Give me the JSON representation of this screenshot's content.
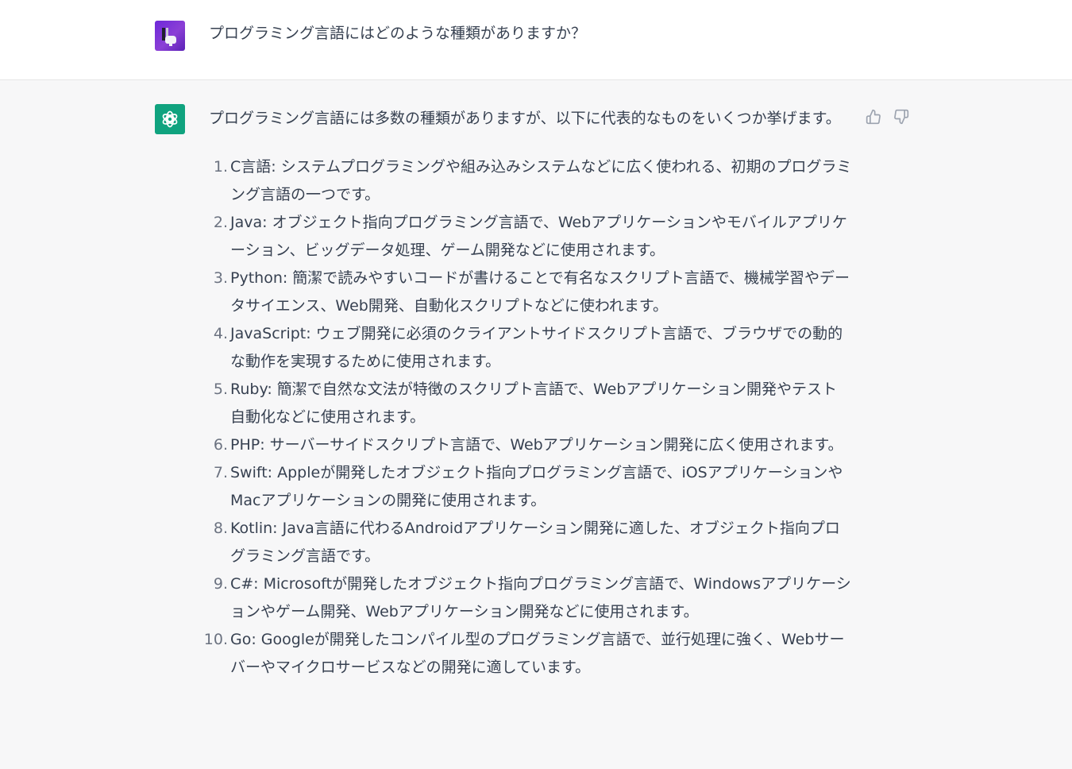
{
  "user_message": {
    "text": "プログラミング言語にはどのような種類がありますか？"
  },
  "assistant_message": {
    "intro": "プログラミング言語には多数の種類がありますが、以下に代表的なものをいくつか挙げます。",
    "items": [
      {
        "num": "1.",
        "text": "C言語: システムプログラミングや組み込みシステムなどに広く使われる、初期のプログラミング言語の一つです。"
      },
      {
        "num": "2.",
        "text": "Java: オブジェクト指向プログラミング言語で、Webアプリケーションやモバイルアプリケーション、ビッグデータ処理、ゲーム開発などに使用されます。"
      },
      {
        "num": "3.",
        "text": "Python: 簡潔で読みやすいコードが書けることで有名なスクリプト言語で、機械学習やデータサイエンス、Web開発、自動化スクリプトなどに使われます。"
      },
      {
        "num": "4.",
        "text": "JavaScript: ウェブ開発に必須のクライアントサイドスクリプト言語で、ブラウザでの動的な動作を実現するために使用されます。"
      },
      {
        "num": "5.",
        "text": "Ruby: 簡潔で自然な文法が特徴のスクリプト言語で、Webアプリケーション開発やテスト自動化などに使用されます。"
      },
      {
        "num": "6.",
        "text": "PHP: サーバーサイドスクリプト言語で、Webアプリケーション開発に広く使用されます。"
      },
      {
        "num": "7.",
        "text": "Swift: Appleが開発したオブジェクト指向プログラミング言語で、iOSアプリケーションやMacアプリケーションの開発に使用されます。"
      },
      {
        "num": "8.",
        "text": "Kotlin: Java言語に代わるAndroidアプリケーション開発に適した、オブジェクト指向プログラミング言語です。"
      },
      {
        "num": "9.",
        "text": "C#: Microsoftが開発したオブジェクト指向プログラミング言語で、Windowsアプリケーションやゲーム開発、Webアプリケーション開発などに使用されます。"
      },
      {
        "num": "10.",
        "text": "Go: Googleが開発したコンパイル型のプログラミング言語で、並行処理に強く、Webサーバーやマイクロサービスなどの開発に適しています。"
      }
    ]
  },
  "icons": {
    "user_avatar": "game-controller-avatar-icon",
    "assistant_avatar": "openai-logo-icon",
    "thumbs_up": "thumbs-up-icon",
    "thumbs_down": "thumbs-down-icon"
  },
  "colors": {
    "assistant_avatar_bg": "#10a37f",
    "user_avatar_bg": "#6d28d9",
    "page_bg": "#f7f7f8",
    "user_row_bg": "#ffffff",
    "text": "#374151",
    "icon": "#9ca3af"
  }
}
